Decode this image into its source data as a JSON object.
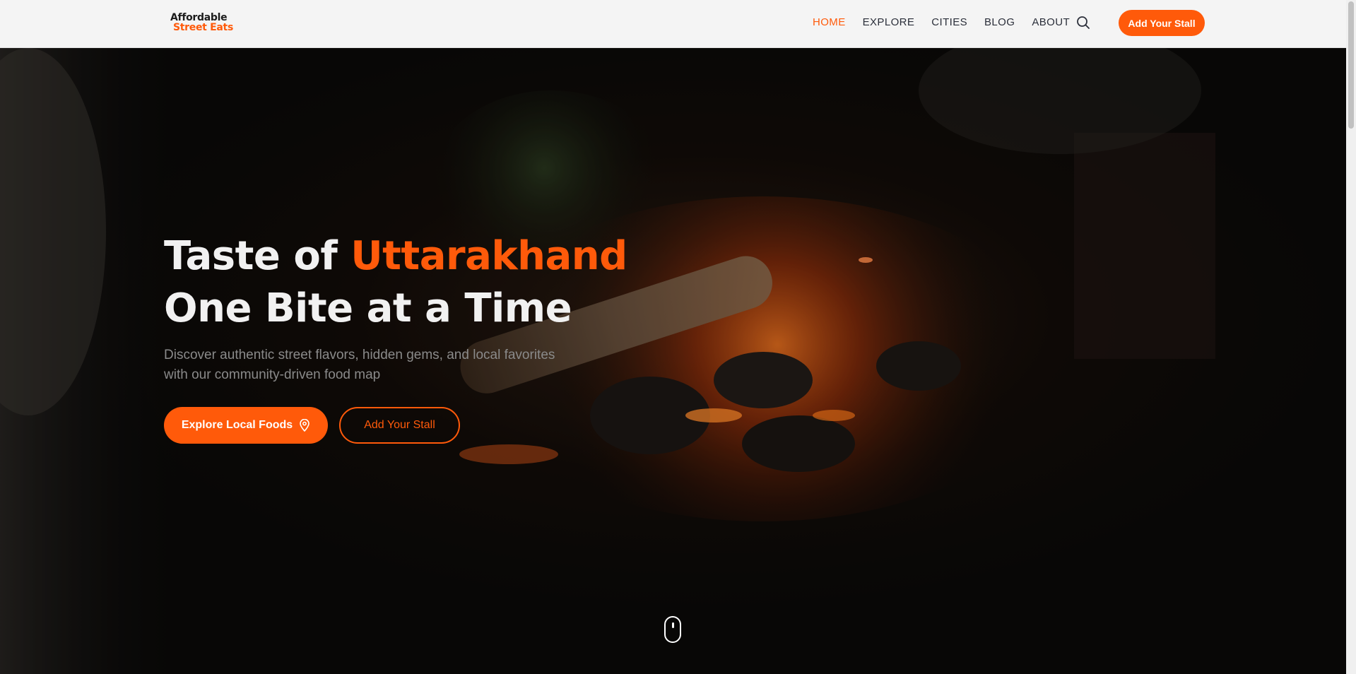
{
  "header": {
    "logo_line1": "Affordable",
    "logo_line2": "Street Eats",
    "nav": [
      {
        "label": "HOME",
        "active": true
      },
      {
        "label": "EXPLORE",
        "active": false
      },
      {
        "label": "CITIES",
        "active": false
      },
      {
        "label": "BLOG",
        "active": false
      },
      {
        "label": "ABOUT",
        "active": false
      }
    ],
    "search_icon": "search-icon",
    "cta_label": "Add Your Stall"
  },
  "hero": {
    "title_prefix": "Taste of ",
    "title_accent": "Uttarakhand",
    "title_line2": "One Bite at a Time",
    "subtitle_line1": "Discover authentic street flavors, hidden gems, and local favorites",
    "subtitle_line2": "with our community-driven food map",
    "primary_button": "Explore Local Foods",
    "primary_button_icon": "map-pin-icon",
    "secondary_button": "Add Your Stall",
    "scroll_indicator_icon": "mouse-scroll-icon"
  },
  "colors": {
    "accent": "#ff5a0a",
    "header_bg": "#f4f4f4",
    "nav_text": "#2b2f3a",
    "hero_bg": "#0b0a09"
  }
}
